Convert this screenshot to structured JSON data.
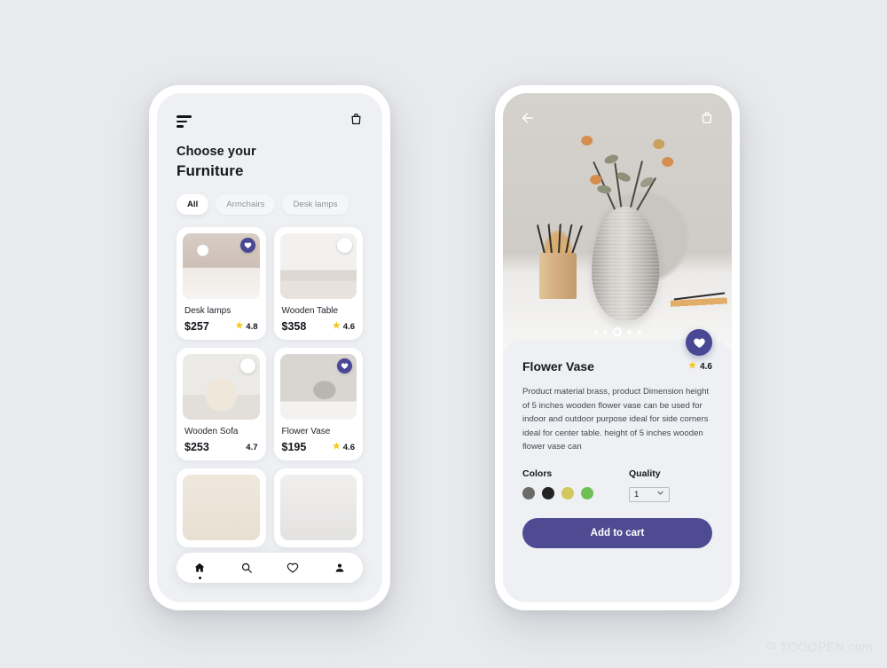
{
  "brand": {
    "accent": "#4a4794",
    "cta": "#4f4b93",
    "star": "#f5c518",
    "background": "#e9eaec"
  },
  "watermark": {
    "text": "TOOOPEN.com"
  },
  "left_screen": {
    "header": {
      "menu_icon": "hamburger-menu-icon",
      "bag_icon": "shopping-bag-icon"
    },
    "title_line1": "Choose your",
    "title_line2": "Furniture",
    "filters": [
      {
        "label": "All",
        "active": true
      },
      {
        "label": "Armchairs",
        "active": false
      },
      {
        "label": "Desk lamps",
        "active": false
      }
    ],
    "products": [
      {
        "name": "Desk lamps",
        "price": "$257",
        "rating": "4.8",
        "has_star": true,
        "favorite": true
      },
      {
        "name": "Wooden Table",
        "price": "$358",
        "rating": "4.6",
        "has_star": true,
        "favorite": false
      },
      {
        "name": "Wooden Sofa",
        "price": "$253",
        "rating": "4.7",
        "has_star": false,
        "favorite": false
      },
      {
        "name": "Flower Vase",
        "price": "$195",
        "rating": "4.6",
        "has_star": true,
        "favorite": true
      }
    ],
    "bottom_nav": [
      {
        "icon": "home-icon",
        "active": true
      },
      {
        "icon": "search-icon",
        "active": false
      },
      {
        "icon": "heart-icon",
        "active": false
      },
      {
        "icon": "person-icon",
        "active": false
      }
    ]
  },
  "right_screen": {
    "header": {
      "back_icon": "back-arrow-icon",
      "bag_icon": "shopping-bag-icon"
    },
    "carousel": {
      "total_dots": 5,
      "active_index": 2
    },
    "favorite_fab": {
      "icon": "heart-icon",
      "active": true
    },
    "product": {
      "title": "Flower Vase",
      "rating": "4.6",
      "description": "Product material brass, product Dimension height of 5 inches wooden flower vase can be used for indoor and outdoor purpose ideal for side corners ideal for center table. height of 5 inches wooden flower vase can"
    },
    "colors": {
      "label": "Colors",
      "swatches": [
        "#6b6b68",
        "#232323",
        "#d2c85c",
        "#6ec055"
      ]
    },
    "quality": {
      "label": "Quality",
      "value": "1"
    },
    "cta_label": "Add to cart"
  }
}
